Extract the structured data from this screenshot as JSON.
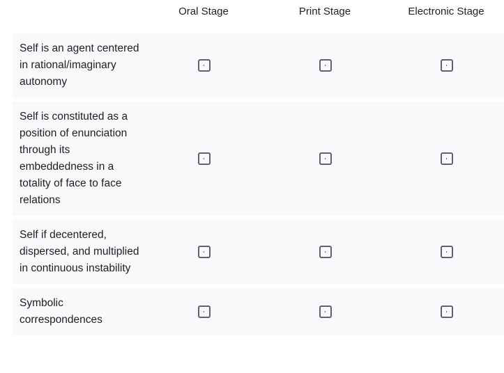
{
  "columns": [
    "Oral Stage",
    "Print Stage",
    "Electronic Stage"
  ],
  "rows": [
    {
      "label": "Self is an agent centered in rational/imaginary autonomy",
      "checked": [
        false,
        false,
        false
      ]
    },
    {
      "label": "Self is constituted as a position of enunciation through its embeddedness in a totality of face to face relations",
      "checked": [
        false,
        false,
        false
      ]
    },
    {
      "label": "Self if decentered, dispersed, and multiplied in continuous instability",
      "checked": [
        false,
        false,
        false
      ]
    },
    {
      "label": "Symbolic correspondences",
      "checked": [
        false,
        false,
        false
      ]
    }
  ],
  "colors": {
    "row_background": "#f8f9fa",
    "checkbox_border": "#5f6368",
    "text": "#202124"
  }
}
